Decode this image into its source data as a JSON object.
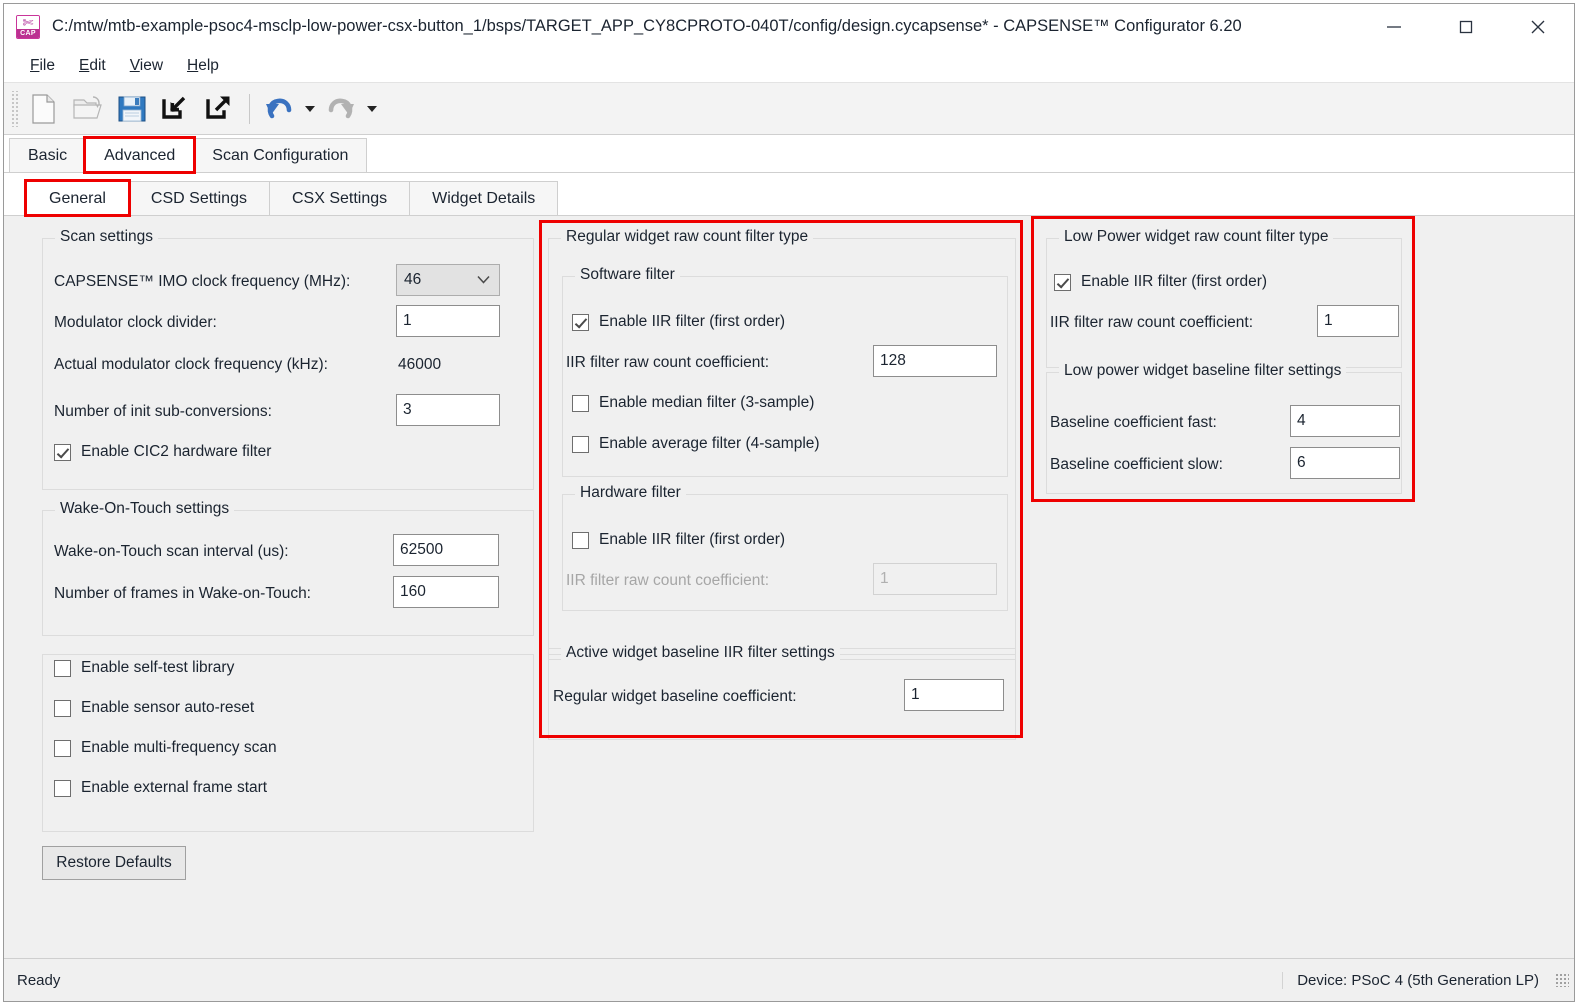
{
  "window": {
    "title": "C:/mtw/mtb-example-psoc4-msclp-low-power-csx-button_1/bsps/TARGET_APP_CY8CPROTO-040T/config/design.cycapsense* - CAPSENSE™ Configurator 6.20",
    "app_icon_label": "CAP",
    "minimize_label": "Minimize",
    "maximize_label": "Maximize",
    "close_label": "Close"
  },
  "menu": {
    "items": [
      {
        "label": "File",
        "mnemonic": "F"
      },
      {
        "label": "Edit",
        "mnemonic": "E"
      },
      {
        "label": "View",
        "mnemonic": "V"
      },
      {
        "label": "Help",
        "mnemonic": "H"
      }
    ]
  },
  "toolbar": {
    "buttons": [
      {
        "name": "new-file-icon",
        "title": "New",
        "enabled": true
      },
      {
        "name": "open-folder-icon",
        "title": "Open",
        "enabled": false
      },
      {
        "name": "save-icon",
        "title": "Save",
        "enabled": true
      },
      {
        "name": "import-icon",
        "title": "Import",
        "enabled": true
      },
      {
        "name": "export-icon",
        "title": "Export",
        "enabled": true
      },
      {
        "name": "undo-icon",
        "title": "Undo",
        "enabled": true
      },
      {
        "name": "redo-icon",
        "title": "Redo",
        "enabled": false
      }
    ]
  },
  "tabs_outer": {
    "items": [
      {
        "label": "Basic",
        "active": false,
        "highlighted": false
      },
      {
        "label": "Advanced",
        "active": true,
        "highlighted": true
      },
      {
        "label": "Scan Configuration",
        "active": false,
        "highlighted": false
      }
    ]
  },
  "tabs_inner": {
    "items": [
      {
        "label": "General",
        "active": true,
        "highlighted": true
      },
      {
        "label": "CSD Settings",
        "active": false,
        "highlighted": false
      },
      {
        "label": "CSX Settings",
        "active": false,
        "highlighted": false
      },
      {
        "label": "Widget Details",
        "active": false,
        "highlighted": false
      }
    ]
  },
  "scan_settings": {
    "group_title": "Scan settings",
    "imo_clock_label": "CAPSENSE™ IMO clock frequency (MHz):",
    "imo_clock_value": "46",
    "mod_divider_label": "Modulator clock divider:",
    "mod_divider_value": "1",
    "actual_mod_label": "Actual modulator clock frequency (kHz):",
    "actual_mod_value": "46000",
    "init_subconv_label": "Number of init sub-conversions:",
    "init_subconv_value": "3",
    "cic2_label": "Enable CIC2 hardware filter",
    "cic2_checked": true
  },
  "wot_settings": {
    "group_title": "Wake-On-Touch settings",
    "scan_interval_label": "Wake-on-Touch scan interval (us):",
    "scan_interval_value": "62500",
    "frames_label": "Number of frames in Wake-on-Touch:",
    "frames_value": "160"
  },
  "misc_options": {
    "items": [
      {
        "label": "Enable self-test library",
        "checked": false
      },
      {
        "label": "Enable sensor auto-reset",
        "checked": false
      },
      {
        "label": "Enable multi-frequency scan",
        "checked": false
      },
      {
        "label": "Enable external frame start",
        "checked": false
      }
    ]
  },
  "restore_defaults": {
    "label": "Restore Defaults"
  },
  "regular_filter": {
    "group_title": "Regular widget raw count filter type",
    "software": {
      "group_title": "Software filter",
      "iir_label": "Enable IIR filter (first order)",
      "iir_checked": true,
      "coeff_label": "IIR filter raw count coefficient:",
      "coeff_value": "128",
      "median_label": "Enable median filter (3-sample)",
      "median_checked": false,
      "average_label": "Enable average filter (4-sample)",
      "average_checked": false
    },
    "hardware": {
      "group_title": "Hardware filter",
      "iir_label": "Enable IIR filter (first order)",
      "iir_checked": false,
      "coeff_label": "IIR filter raw count coefficient:",
      "coeff_value": "1",
      "coeff_disabled": true
    },
    "baseline": {
      "group_title": "Active widget baseline IIR filter settings",
      "coeff_label": "Regular widget baseline coefficient:",
      "coeff_value": "1"
    }
  },
  "low_power_filter": {
    "group_title": "Low Power widget raw count filter type",
    "iir_label": "Enable IIR filter (first order)",
    "iir_checked": true,
    "coeff_label": "IIR filter raw count coefficient:",
    "coeff_value": "1",
    "baseline": {
      "group_title": "Low power widget baseline filter settings",
      "fast_label": "Baseline coefficient fast:",
      "fast_value": "4",
      "slow_label": "Baseline coefficient slow:",
      "slow_value": "6"
    }
  },
  "statusbar": {
    "status": "Ready",
    "device": "Device: PSoC 4 (5th Generation LP)"
  },
  "colors": {
    "highlight": "#ee0000",
    "window_bg": "#f0f0f0",
    "accent": "#2a6fc4"
  }
}
